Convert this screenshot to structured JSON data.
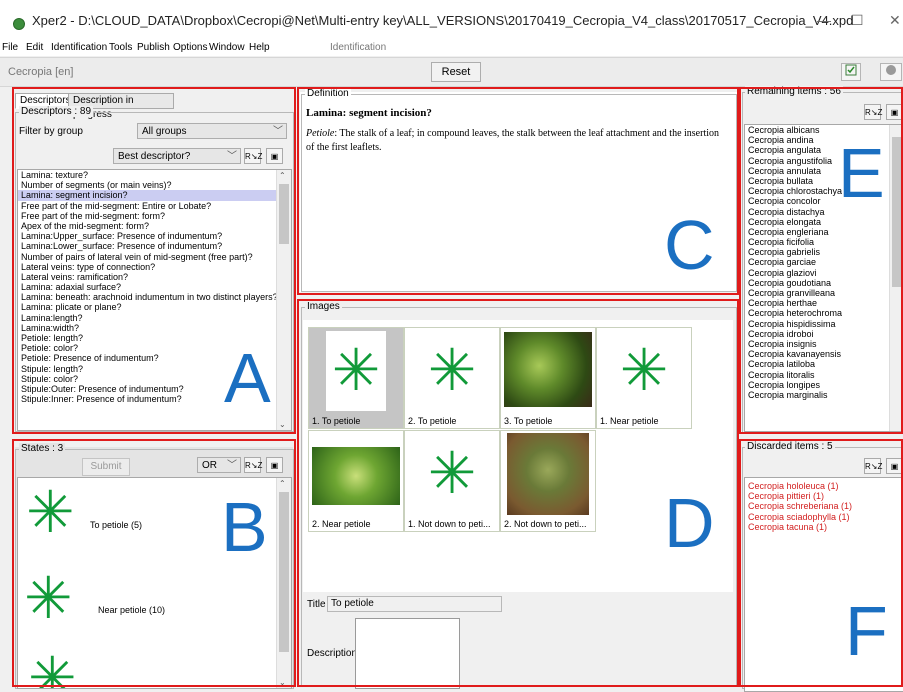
{
  "window": {
    "title": "Xper2 - D:\\CLOUD_DATA\\Dropbox\\Cecropi@Net\\Multi-entry key\\ALL_VERSIONS\\20170419_Cecropia_V4_class\\20170517_Cecropia_V4.xpd",
    "minimize": "—",
    "maximize": "☐",
    "close": "✕"
  },
  "menu": {
    "items": [
      "File",
      "Edit",
      "Identification",
      "Tools",
      "Publish",
      "Options",
      "Window",
      "Help"
    ],
    "mode_label": "Identification"
  },
  "toolbar": {
    "key_name": "Cecropia [en]",
    "reset_label": "Reset"
  },
  "annotations": {
    "a": "A",
    "b": "B",
    "c": "C",
    "d": "D",
    "e": "E",
    "f": "F"
  },
  "descriptors_panel": {
    "tabs": [
      "Descriptors",
      "Description in progress"
    ],
    "group_title": "Descriptors : 89",
    "filter_label": "Filter by group",
    "filter_value": "All groups",
    "sort_value": "Best descriptor?",
    "items": [
      "Lamina: texture?",
      "Number of segments (or main veins)?",
      "Lamina: segment incision?",
      "Free part of the mid-segment: Entire or Lobate?",
      "Free part of the mid-segment: form?",
      "Apex of the mid-segment: form?",
      "Lamina:Upper_surface: Presence of indumentum?",
      "Lamina:Lower_surface: Presence of indumentum?",
      "Number of pairs of lateral vein of mid-segment (free part)?",
      "Lateral veins: type of connection?",
      "Lateral veins: ramification?",
      "Lamina: adaxial surface?",
      "Lamina: beneath: arachnoid indumentum in two distinct players?",
      "Lamina: plicate or plane?",
      "Lamina:length?",
      "Lamina:width?",
      "Petiole: length?",
      "Petiole: color?",
      "Petiole: Presence of indumentum?",
      "Stipule: length?",
      "Stipule: color?",
      "Stipule:Outer: Presence of indumentum?",
      "Stipule:Inner: Presence of indumentum?"
    ],
    "selected_index": 2
  },
  "states_panel": {
    "title": "States : 3",
    "submit_label": "Submit",
    "operator_value": "OR",
    "states": [
      "To petiole (5)",
      "Near petiole (10)"
    ]
  },
  "definition_panel": {
    "legend": "Definition",
    "heading": "Lamina: segment incision?",
    "term": "Petiole",
    "text": ": The stalk of a leaf; in compound leaves, the stalk between the leaf attachment and the insertion of the first leaflets."
  },
  "images_panel": {
    "legend": "Images",
    "captions": [
      "1. To petiole",
      "2. To petiole",
      "3. To petiole",
      "1. Near petiole",
      "2. Near petiole",
      "1. Not down to peti...",
      "2. Not down to peti..."
    ],
    "title_label": "Title",
    "title_value": "To petiole",
    "description_label": "Description"
  },
  "remaining_panel": {
    "title": "Remaining items : 56",
    "items": [
      "Cecropia albicans",
      "Cecropia andina",
      "Cecropia angulata",
      "Cecropia angustifolia",
      "Cecropia annulata",
      "Cecropia bullata",
      "Cecropia chlorostachya",
      "Cecropia concolor",
      "Cecropia distachya",
      "Cecropia elongata",
      "Cecropia engleriana",
      "Cecropia ficifolia",
      "Cecropia gabrielis",
      "Cecropia garciae",
      "Cecropia glaziovi",
      "Cecropia goudotiana",
      "Cecropia granvilleana",
      "Cecropia herthae",
      "Cecropia heterochroma",
      "Cecropia hispidissima",
      "Cecropia idroboi",
      "Cecropia insignis",
      "Cecropia kavanayensis",
      "Cecropia latiloba",
      "Cecropia litoralis",
      "Cecropia longipes",
      "Cecropia marginalis"
    ]
  },
  "discarded_panel": {
    "title": "Discarded items : 5",
    "items": [
      "Cecropia hololeuca (1)",
      "Cecropia pittieri (1)",
      "Cecropia schreberiana (1)",
      "Cecropia sciadophylla (1)",
      "Cecropia tacuna (1)"
    ]
  },
  "colors": {
    "highlight_box": "#e01b1b",
    "annotation_letter": "#1b6fc1",
    "discarded_text": "#d21f1f",
    "leaf_green": "#119a39",
    "selection": "#cbcdf2"
  },
  "icons": {
    "sort": "sort-az-icon",
    "display": "display-mode-icon",
    "check": "check-icon",
    "help": "help-icon"
  }
}
